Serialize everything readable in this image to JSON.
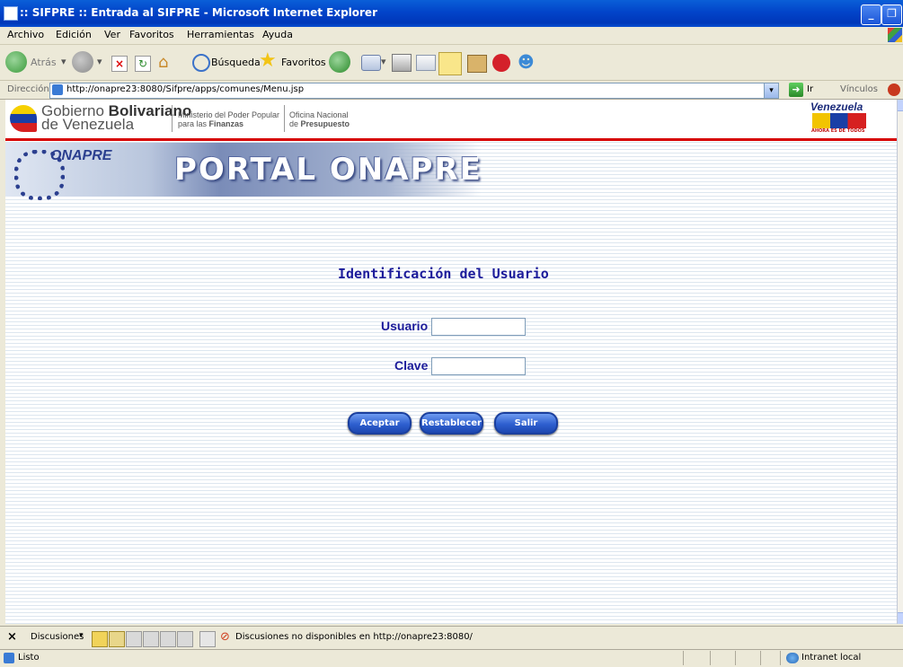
{
  "window": {
    "title": ":: SIFPRE :: Entrada al SIFPRE - Microsoft Internet Explorer"
  },
  "menu": [
    "Archivo",
    "Edición",
    "Ver",
    "Favoritos",
    "Herramientas",
    "Ayuda"
  ],
  "toolbar": {
    "back": "Atrás",
    "search": "Búsqueda",
    "favorites": "Favoritos"
  },
  "address": {
    "label": "Dirección",
    "url": "http://onapre23:8080/Sifpre/apps/comunes/Menu.jsp",
    "go": "Ir",
    "links": "Vínculos"
  },
  "header": {
    "gob_line1": "Gobierno",
    "gob_bold": "Bolivariano",
    "gob_line2": "de Venezuela",
    "min_line1": "Ministerio del Poder Popular",
    "min_line2_pre": "para las",
    "min_line2_bold": "Finanzas",
    "ofi_line1": "Oficina Nacional",
    "ofi_line2_pre": "de",
    "ofi_line2_bold": "Presupuesto",
    "venezuela": "Venezuela",
    "ahora": "AHORA ES DE TODOS"
  },
  "banner": {
    "logo_text": "ONAPRE",
    "title": "PORTAL ONAPRE"
  },
  "login": {
    "heading": "Identificación del Usuario",
    "user_label": "Usuario",
    "user_value": "",
    "pass_label": "Clave",
    "pass_value": "",
    "accept": "Aceptar",
    "reset": "Restablecer",
    "exit": "Salir"
  },
  "discussions": {
    "label": "Discusiones",
    "message": "Discusiones no disponibles en http://onapre23:8080/"
  },
  "status": {
    "text": "Listo",
    "zone": "Intranet local"
  },
  "colors": {
    "titlebar": "#0244c9",
    "form_label": "#1b1b9a",
    "button": "#2e5fcf",
    "header_red": "#d60000"
  }
}
